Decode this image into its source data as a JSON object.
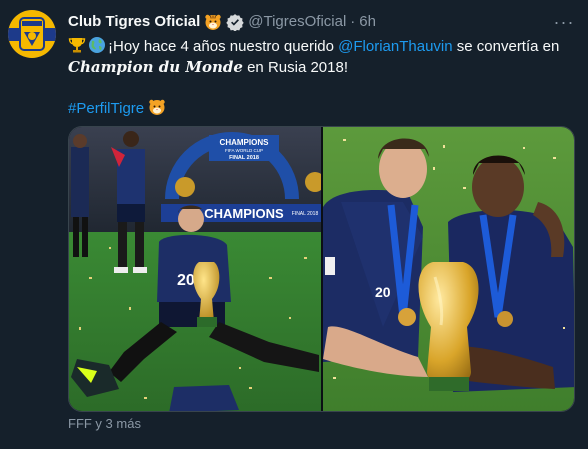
{
  "tweet": {
    "author_name": "Club Tigres Oficial",
    "handle": "@TigresOficial",
    "separator": "·",
    "time": "6h",
    "more": "···",
    "body": {
      "line1_text": "¡Hoy hace 4 años nuestro querido ",
      "line1_mention": "@FlorianThauvin",
      "line1_tail": " se convertía en",
      "line2_fancy": "Champion du Monde",
      "line2_tail": " en Rusia 2018!",
      "hashtag": "#PerfilTigre"
    },
    "media": {
      "left_banner_top": "CHAMPIONS",
      "left_banner_sub": "FIFA WORLD CUP",
      "left_banner_final": "FINAL 2018",
      "left_board_text": "CHAMPIONS",
      "left_board_small": "FINAL 2018",
      "left_shirt_number": "20",
      "right_shirt_number": "20"
    },
    "tagged": "FFF y 3 más"
  },
  "colors": {
    "background": "#15202b",
    "text": "#f7f9f9",
    "secondary": "#8b98a5",
    "link": "#1d9bf0",
    "border": "#38444d"
  },
  "icons": [
    "tigres-crest-avatar",
    "tiger-emoji",
    "verified-badge-icon",
    "trophy-emoji",
    "globe-emoji",
    "more-icon"
  ]
}
